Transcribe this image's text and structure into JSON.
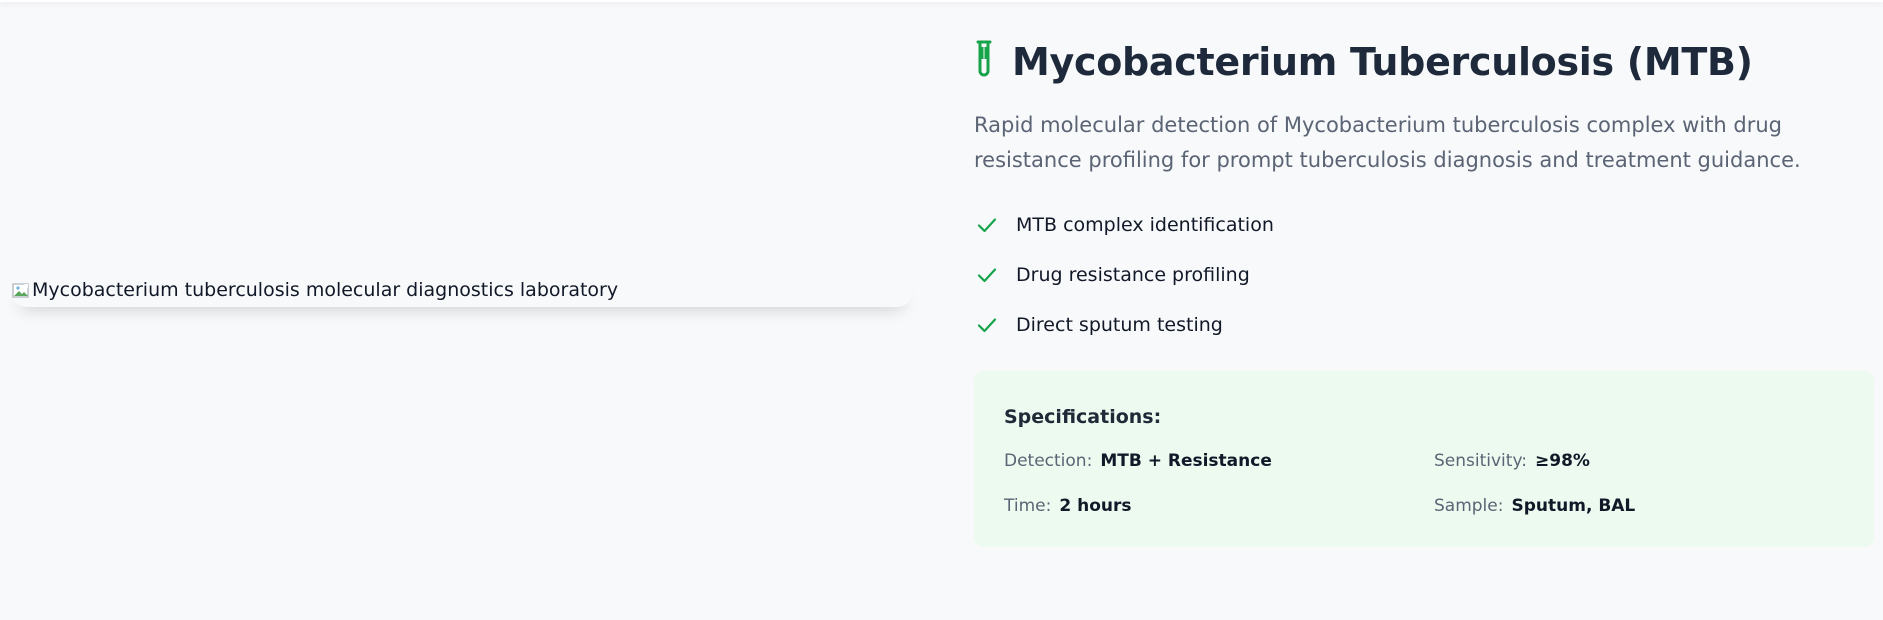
{
  "image": {
    "alt": "Mycobacterium tuberculosis molecular diagnostics laboratory"
  },
  "product": {
    "icon": "test-tube-icon",
    "title": "Mycobacterium Tuberculosis (MTB)",
    "description": "Rapid molecular detection of Mycobacterium tuberculosis complex with drug resistance profiling for prompt tuberculosis diagnosis and treatment guidance."
  },
  "features": [
    "MTB complex identification",
    "Drug resistance profiling",
    "Direct sputum testing"
  ],
  "specifications": {
    "title": "Specifications:",
    "detection": {
      "label": "Detection:",
      "value": "MTB + Resistance"
    },
    "sensitivity": {
      "label": "Sensitivity:",
      "value": "≥98%"
    },
    "time": {
      "label": "Time:",
      "value": "2 hours"
    },
    "sample": {
      "label": "Sample:",
      "value": "Sputum, BAL"
    }
  },
  "colors": {
    "accent_green": "#16a34a",
    "title": "#1e2a3b",
    "muted_text": "#5b6474",
    "spec_background": "#ecfaf0",
    "page_background": "#f8f9fb"
  }
}
